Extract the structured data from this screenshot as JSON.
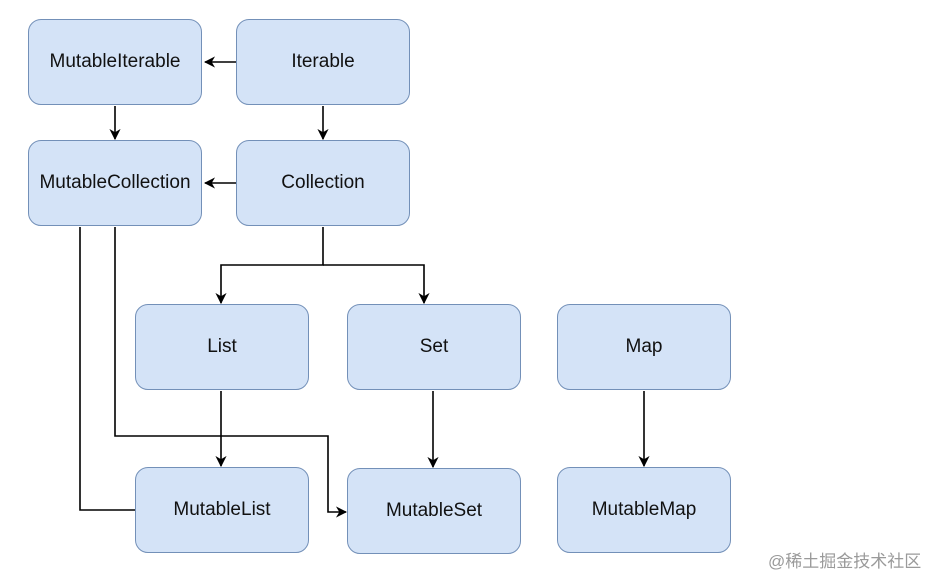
{
  "nodes": {
    "mutable_iterable": "MutableIterable",
    "iterable": "Iterable",
    "mutable_collection": "MutableCollection",
    "collection": "Collection",
    "list": "List",
    "set": "Set",
    "map": "Map",
    "mutable_list": "MutableList",
    "mutable_set": "MutableSet",
    "mutable_map": "MutableMap"
  },
  "colors": {
    "node_fill": "#d4e3f7",
    "node_border": "#7390b8",
    "edge": "#000000"
  },
  "watermark": "@稀土掘金技术社区"
}
